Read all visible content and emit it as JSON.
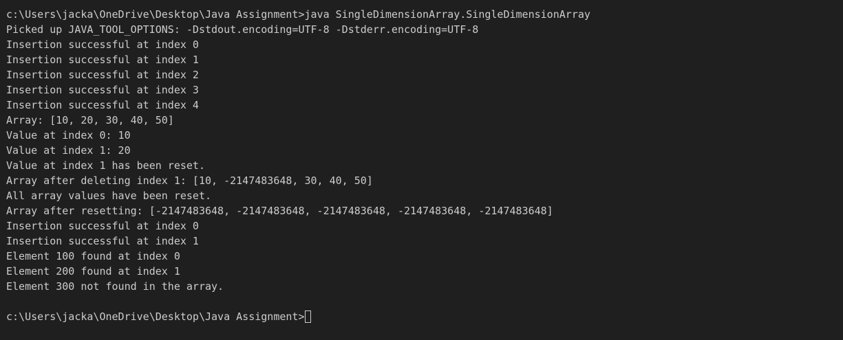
{
  "terminal": {
    "command_line": "c:\\Users\\jacka\\OneDrive\\Desktop\\Java Assignment>java SingleDimensionArray.SingleDimensionArray",
    "output": [
      "Picked up JAVA_TOOL_OPTIONS: -Dstdout.encoding=UTF-8 -Dstderr.encoding=UTF-8",
      "Insertion successful at index 0",
      "Insertion successful at index 1",
      "Insertion successful at index 2",
      "Insertion successful at index 3",
      "Insertion successful at index 4",
      "Array: [10, 20, 30, 40, 50]",
      "Value at index 0: 10",
      "Value at index 1: 20",
      "Value at index 1 has been reset.",
      "Array after deleting index 1: [10, -2147483648, 30, 40, 50]",
      "All array values have been reset.",
      "Array after resetting: [-2147483648, -2147483648, -2147483648, -2147483648, -2147483648]",
      "Insertion successful at index 0",
      "Insertion successful at index 1",
      "Element 100 found at index 0",
      "Element 200 found at index 1",
      "Element 300 not found in the array."
    ],
    "prompt": "c:\\Users\\jacka\\OneDrive\\Desktop\\Java Assignment>",
    "colors": {
      "background": "#1f1f1f",
      "text": "#cccccc"
    }
  }
}
